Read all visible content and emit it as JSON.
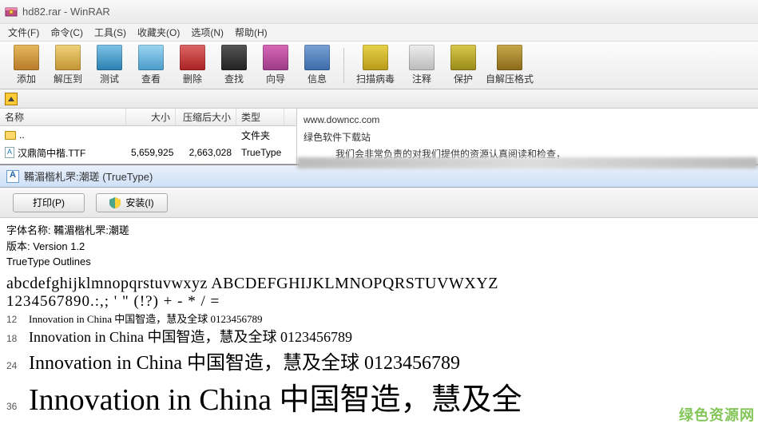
{
  "window": {
    "title": "hd82.rar - WinRAR"
  },
  "menu": {
    "file": "文件(F)",
    "cmd": "命令(C)",
    "tools": "工具(S)",
    "fav": "收藏夹(O)",
    "opt": "选项(N)",
    "help": "帮助(H)"
  },
  "toolbar": {
    "add": "添加",
    "extract": "解压到",
    "test": "测试",
    "view": "查看",
    "delete": "删除",
    "find": "查找",
    "wizard": "向导",
    "info": "信息",
    "scan": "扫描病毒",
    "comment": "注释",
    "protect": "保护",
    "sfx": "自解压格式"
  },
  "columns": {
    "name": "名称",
    "size": "大小",
    "packed": "压缩后大小",
    "type": "类型"
  },
  "files": [
    {
      "name": "..",
      "size": "",
      "packed": "",
      "type": "文件夹",
      "icon": "folder"
    },
    {
      "name": "汉鼎简中楷.TTF",
      "size": "5,659,925",
      "packed": "2,663,028",
      "type": "TrueType",
      "icon": "ttf"
    }
  ],
  "comment": {
    "line1": "www.downcc.com",
    "line2": "绿色软件下载站",
    "line3": "我们会非常负责的对我们提供的资源认真阅读和检查，"
  },
  "fontwin": {
    "title": "鞴湄楷札罘:潮瑳 (TrueType)",
    "print": "打印(P)",
    "install": "安装(I)",
    "meta_name": "字体名称: 鞴湄楷札罘:潮瑳",
    "meta_ver": "版本: Version 1.2",
    "meta_out": "TrueType Outlines",
    "alpha": "abcdefghijklmnopqrstuvwxyz  ABCDEFGHIJKLMNOPQRSTUVWXYZ",
    "nums": "1234567890.:,;  '  \"  (!?)  + - * / =",
    "s12n": "12",
    "s12": "Innovation in China 中国智造，慧及全球 0123456789",
    "s18n": "18",
    "s18": "Innovation in China 中国智造，慧及全球 0123456789",
    "s24n": "24",
    "s24": "Innovation in China 中国智造，慧及全球 0123456789",
    "s36n": "36",
    "s36": "Innovation in China 中国智造，慧及全"
  },
  "watermark": "绿色资源网"
}
